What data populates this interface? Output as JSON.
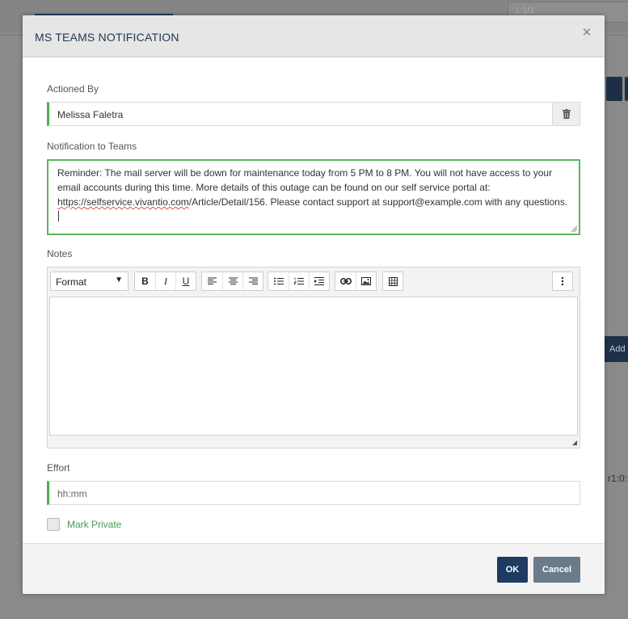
{
  "background": {
    "field_value": "1:1/1",
    "add_button_label": "Add",
    "side_text": "r1:0:"
  },
  "modal": {
    "title": "MS TEAMS NOTIFICATION",
    "close_icon": "close-icon",
    "actioned_by": {
      "label": "Actioned By",
      "value": "Melissa Faletra",
      "clear_icon": "trash-icon"
    },
    "notification": {
      "label": "Notification to Teams",
      "text_part1": "Reminder: The mail server will be down for maintenance today from 5 PM to 8 PM. You will not have access to your email accounts during this time. More details of this outage can be found on our self service portal at: ",
      "link_prefix": "https://",
      "link_underlined": "selfservice.vivantio.com",
      "link_suffix": "/Article/Detail/156.",
      "text_part2": " Please contact support at support@example.com with any questions."
    },
    "notes": {
      "label": "Notes",
      "format_select": "Format",
      "toolbar_icons": [
        "bold-icon",
        "italic-icon",
        "underline-icon",
        "align-left-icon",
        "align-center-icon",
        "align-right-icon",
        "bullet-list-icon",
        "numbered-list-icon",
        "indent-icon",
        "link-icon",
        "image-icon",
        "table-icon",
        "more-icon"
      ],
      "bold": "B",
      "italic": "I",
      "underline": "U"
    },
    "effort": {
      "label": "Effort",
      "placeholder": "hh:mm"
    },
    "mark_private": {
      "label": "Mark Private",
      "checked": false
    },
    "footer": {
      "ok_label": "OK",
      "cancel_label": "Cancel"
    },
    "colors": {
      "accent_green": "#4caf50",
      "primary_navy": "#1e3b63",
      "secondary_gray": "#6b7b8a"
    }
  }
}
